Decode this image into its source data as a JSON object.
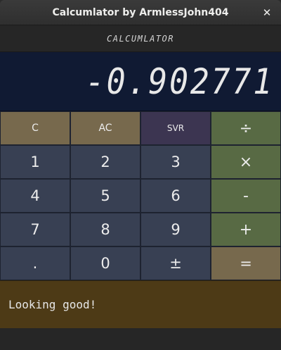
{
  "window": {
    "title": "Calcumlator by ArmlessJohn404",
    "close_glyph": "✕"
  },
  "header": {
    "label": "CALCUMLATOR"
  },
  "display": {
    "value": "-0.902771"
  },
  "keys": [
    {
      "id": "clear",
      "label": "C",
      "kind": "func"
    },
    {
      "id": "all-clear",
      "label": "AC",
      "kind": "func"
    },
    {
      "id": "svr",
      "label": "SVR",
      "kind": "svr"
    },
    {
      "id": "divide",
      "label": "÷",
      "kind": "op"
    },
    {
      "id": "1",
      "label": "1",
      "kind": "num"
    },
    {
      "id": "2",
      "label": "2",
      "kind": "num"
    },
    {
      "id": "3",
      "label": "3",
      "kind": "num"
    },
    {
      "id": "multiply",
      "label": "×",
      "kind": "op"
    },
    {
      "id": "4",
      "label": "4",
      "kind": "num"
    },
    {
      "id": "5",
      "label": "5",
      "kind": "num"
    },
    {
      "id": "6",
      "label": "6",
      "kind": "num"
    },
    {
      "id": "subtract",
      "label": "-",
      "kind": "op"
    },
    {
      "id": "7",
      "label": "7",
      "kind": "num"
    },
    {
      "id": "8",
      "label": "8",
      "kind": "num"
    },
    {
      "id": "9",
      "label": "9",
      "kind": "num"
    },
    {
      "id": "add",
      "label": "+",
      "kind": "op"
    },
    {
      "id": "decimal",
      "label": ".",
      "kind": "num"
    },
    {
      "id": "0",
      "label": "0",
      "kind": "num"
    },
    {
      "id": "plus-minus",
      "label": "±",
      "kind": "num"
    },
    {
      "id": "equals",
      "label": "=",
      "kind": "eq"
    }
  ],
  "status": {
    "message": "Looking good!"
  },
  "colors": {
    "display_bg": "#101a33",
    "number_key": "#384053",
    "function_key": "#77694d",
    "svr_key": "#3c3551",
    "operator_key": "#586a44",
    "status_bg": "#4d3a16"
  }
}
